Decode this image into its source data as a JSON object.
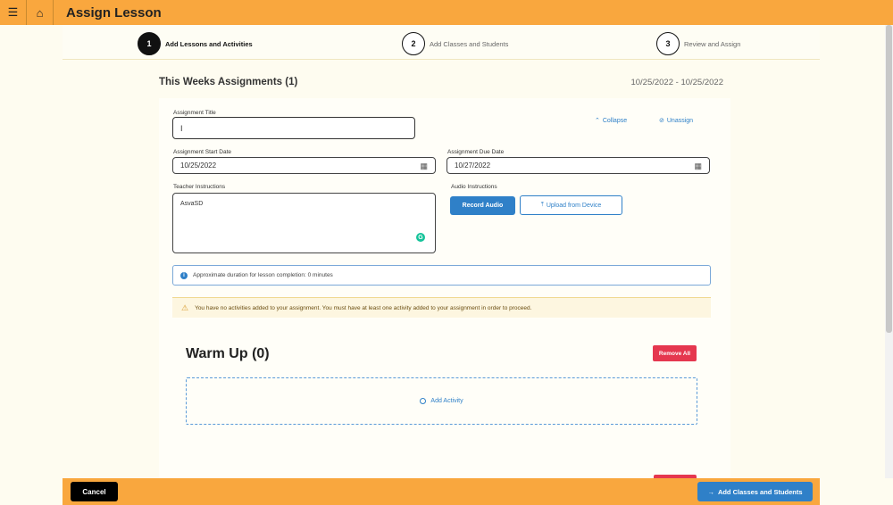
{
  "topbar": {
    "title": "Assign Lesson",
    "menu_icon": "☰",
    "home_icon": "⌂"
  },
  "stepper": {
    "steps": [
      {
        "number": "1",
        "label": "Add Lessons and Activities"
      },
      {
        "number": "2",
        "label": "Add Classes and Students"
      },
      {
        "number": "3",
        "label": "Review and Assign"
      }
    ]
  },
  "header": {
    "title": "This Weeks Assignments (1)",
    "dates": "10/25/2022 - 10/25/2022"
  },
  "form": {
    "title_label": "Assignment Title",
    "title_value": "",
    "collapse_label": "Collapse",
    "unassign_label": "Unassign",
    "start_label": "Assignment Start Date",
    "start_value": "10/25/2022",
    "due_label": "Assignment Due Date",
    "due_value": "10/27/2022",
    "instructions_label": "Teacher Instructions",
    "instructions_value": "AsvaSD",
    "audio_label": "Audio Instructions",
    "record_label": "Record Audio",
    "upload_label": "Upload from Device"
  },
  "info": {
    "text": "Approximate duration for lesson completion: 0 minutes"
  },
  "warning": {
    "text": "You have no activities added to your assignment. You must have at least one activity added to your assignment in order to proceed."
  },
  "warmup": {
    "title": "Warm Up (0)",
    "remove_label": "Remove All",
    "add_label": "Add Activity"
  },
  "footer": {
    "cancel_label": "Cancel",
    "next_label": "Add Classes and Students"
  },
  "colors": {
    "accent": "#f9a73e",
    "primary": "#2f80c8",
    "danger": "#e5374f"
  }
}
